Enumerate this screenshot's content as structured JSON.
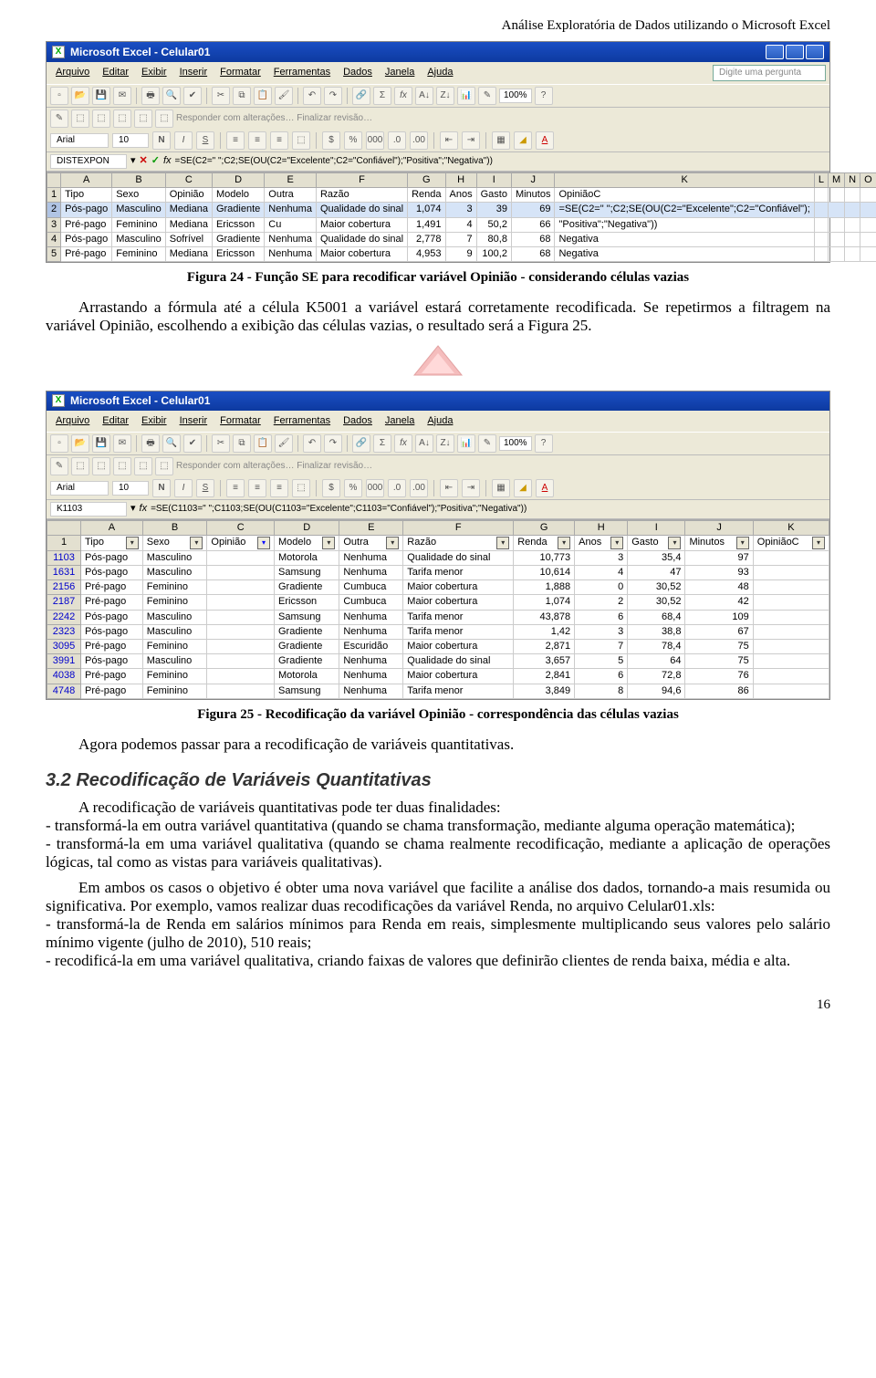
{
  "header_right": "Análise Exploratória de Dados utilizando o Microsoft Excel",
  "excel1": {
    "title": "Microsoft Excel - Celular01",
    "menu": [
      "Arquivo",
      "Editar",
      "Exibir",
      "Inserir",
      "Formatar",
      "Ferramentas",
      "Dados",
      "Janela",
      "Ajuda"
    ],
    "qbox": "Digite uma pergunta",
    "pct": "100%",
    "rev": "Responder com alterações…  Finalizar revisão…",
    "font": "Arial",
    "fontsize": "10",
    "cellname": "DISTEXPON",
    "formula": "=SE(C2=\" \";C2;SE(OU(C2=\"Excelente\";C2=\"Confiável\");\"Positiva\";\"Negativa\"))",
    "cols": [
      "A",
      "B",
      "C",
      "D",
      "E",
      "F",
      "G",
      "H",
      "I",
      "J",
      "K",
      "L",
      "M",
      "N",
      "O"
    ],
    "headers_row": [
      "1",
      "Tipo",
      "Sexo",
      "Opinião",
      "Modelo",
      "Outra",
      "Razão",
      "Renda",
      "Anos",
      "Gasto",
      "Minutos",
      "OpiniãoC",
      "",
      "",
      "",
      ""
    ],
    "rows": [
      [
        "2",
        "Pós-pago",
        "Masculino",
        "Mediana",
        "Gradiente",
        "Nenhuma",
        "Qualidade do sinal",
        "1,074",
        "3",
        "39",
        "69",
        "=SE(C2=\" \";C2;SE(OU(C2=\"Excelente\";C2=\"Confiável\");",
        "",
        "",
        "",
        ""
      ],
      [
        "3",
        "Pré-pago",
        "Feminino",
        "Mediana",
        "Ericsson",
        "Cu",
        "Maior cobertura",
        "1,491",
        "4",
        "50,2",
        "66",
        "\"Positiva\";\"Negativa\"))",
        "",
        "",
        "",
        ""
      ],
      [
        "4",
        "Pós-pago",
        "Masculino",
        "Sofrível",
        "Gradiente",
        "Nenhuma",
        "Qualidade do sinal",
        "2,778",
        "7",
        "80,8",
        "68",
        "Negativa",
        "",
        "",
        "",
        ""
      ],
      [
        "5",
        "Pré-pago",
        "Feminino",
        "Mediana",
        "Ericsson",
        "Nenhuma",
        "Maior cobertura",
        "4,953",
        "9",
        "100,2",
        "68",
        "Negativa",
        "",
        "",
        "",
        ""
      ]
    ]
  },
  "caption1": "Figura 24 - Função SE para recodificar variável Opinião - considerando células vazias",
  "para1": "Arrastando a fórmula até a célula K5001 a variável estará corretamente recodificada. Se repetirmos a filtragem na variável Opinião, escolhendo a exibição das células vazias, o resultado será a Figura 25.",
  "excel2": {
    "title": "Microsoft Excel - Celular01",
    "menu": [
      "Arquivo",
      "Editar",
      "Exibir",
      "Inserir",
      "Formatar",
      "Ferramentas",
      "Dados",
      "Janela",
      "Ajuda"
    ],
    "pct": "100%",
    "rev": "Responder com alterações…  Finalizar revisão…",
    "font": "Arial",
    "fontsize": "10",
    "cellname": "K1103",
    "formula": "=SE(C1103=\" \";C1103;SE(OU(C1103=\"Excelente\";C1103=\"Confiável\");\"Positiva\";\"Negativa\"))",
    "cols": [
      "A",
      "B",
      "C",
      "D",
      "E",
      "F",
      "G",
      "H",
      "I",
      "J",
      "K"
    ],
    "headers": [
      "Tipo",
      "Sexo",
      "Opinião",
      "Modelo",
      "Outra",
      "Razão",
      "Renda",
      "Anos",
      "Gasto",
      "Minutos",
      "OpiniãoC"
    ],
    "rows": [
      [
        "1103",
        "Pós-pago",
        "Masculino",
        "",
        "Motorola",
        "Nenhuma",
        "Qualidade do sinal",
        "10,773",
        "3",
        "35,4",
        "97",
        ""
      ],
      [
        "1631",
        "Pós-pago",
        "Masculino",
        "",
        "Samsung",
        "Nenhuma",
        "Tarifa menor",
        "10,614",
        "4",
        "47",
        "93",
        ""
      ],
      [
        "2156",
        "Pré-pago",
        "Feminino",
        "",
        "Gradiente",
        "Cumbuca",
        "Maior cobertura",
        "1,888",
        "0",
        "30,52",
        "48",
        ""
      ],
      [
        "2187",
        "Pré-pago",
        "Feminino",
        "",
        "Ericsson",
        "Cumbuca",
        "Maior cobertura",
        "1,074",
        "2",
        "30,52",
        "42",
        ""
      ],
      [
        "2242",
        "Pós-pago",
        "Masculino",
        "",
        "Samsung",
        "Nenhuma",
        "Tarifa menor",
        "43,878",
        "6",
        "68,4",
        "109",
        ""
      ],
      [
        "2323",
        "Pós-pago",
        "Masculino",
        "",
        "Gradiente",
        "Nenhuma",
        "Tarifa menor",
        "1,42",
        "3",
        "38,8",
        "67",
        ""
      ],
      [
        "3095",
        "Pré-pago",
        "Feminino",
        "",
        "Gradiente",
        "Escuridão",
        "Maior cobertura",
        "2,871",
        "7",
        "78,4",
        "75",
        ""
      ],
      [
        "3991",
        "Pós-pago",
        "Masculino",
        "",
        "Gradiente",
        "Nenhuma",
        "Qualidade do sinal",
        "3,657",
        "5",
        "64",
        "75",
        ""
      ],
      [
        "4038",
        "Pré-pago",
        "Feminino",
        "",
        "Motorola",
        "Nenhuma",
        "Maior cobertura",
        "2,841",
        "6",
        "72,8",
        "76",
        ""
      ],
      [
        "4748",
        "Pré-pago",
        "Feminino",
        "",
        "Samsung",
        "Nenhuma",
        "Tarifa menor",
        "3,849",
        "8",
        "94,6",
        "86",
        ""
      ]
    ]
  },
  "caption2": "Figura 25 - Recodificação da variável Opinião - correspondência das células vazias",
  "para2": "Agora podemos passar para a recodificação de variáveis quantitativas.",
  "h3": "3.2 Recodificação de Variáveis Quantitativas",
  "p3a": "A recodificação de variáveis quantitativas pode ter duas finalidades:",
  "p3b": "- transformá-la em outra variável quantitativa (quando se chama transformação, mediante alguma operação matemática);",
  "p3c": "- transformá-la em uma variável qualitativa (quando se chama realmente recodificação, mediante a aplicação de operações lógicas, tal como as vistas para variáveis qualitativas).",
  "p4": "Em ambos os casos o objetivo é obter uma nova variável que facilite a análise dos dados, tornando-a mais resumida ou significativa. Por exemplo, vamos realizar duas recodificações da variável Renda, no arquivo Celular01.xls:",
  "p4a": "- transformá-la de Renda em salários mínimos para Renda em reais, simplesmente multiplicando seus valores pelo salário mínimo vigente (julho de 2010), 510 reais;",
  "p4b": "- recodificá-la em uma variável qualitativa, criando faixas de valores que definirão clientes de renda baixa, média e alta.",
  "pagenum": "16"
}
